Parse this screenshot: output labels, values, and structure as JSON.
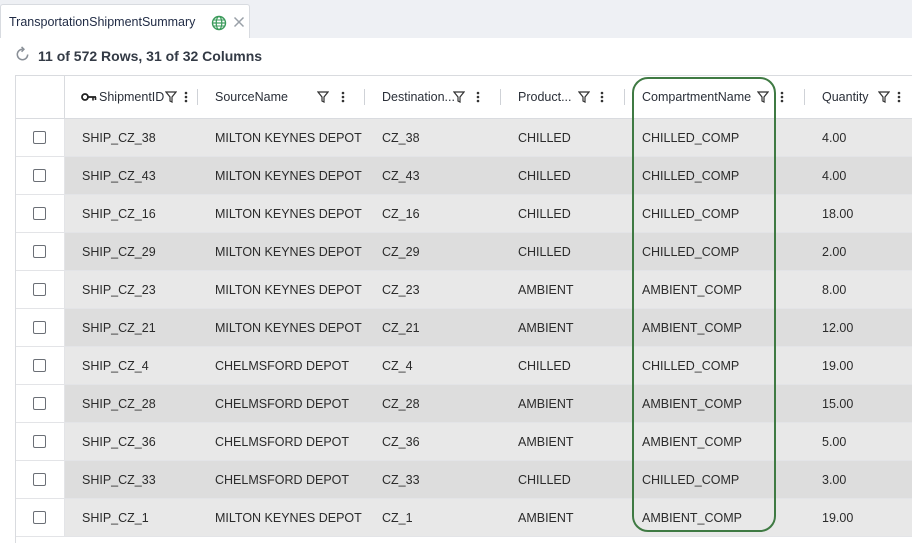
{
  "tab": {
    "title": "TransportationShipmentSummary",
    "globe_icon": "globe-icon",
    "close_icon": "close-icon",
    "globe_color": "#3a9a5a"
  },
  "summary": {
    "text": "11 of 572 Rows, 31 of 32 Columns"
  },
  "grid": {
    "columns": [
      {
        "key": "shipment_id",
        "label": "ShipmentID",
        "has_key_icon": true
      },
      {
        "key": "source_name",
        "label": "SourceName"
      },
      {
        "key": "destination",
        "label": "Destination..."
      },
      {
        "key": "product",
        "label": "Product..."
      },
      {
        "key": "compartment_name",
        "label": "CompartmentName",
        "highlighted": true
      },
      {
        "key": "quantity",
        "label": "Quantity"
      }
    ],
    "rows": [
      [
        "SHIP_CZ_38",
        "MILTON KEYNES DEPOT",
        "CZ_38",
        "CHILLED",
        "CHILLED_COMP",
        "4.00"
      ],
      [
        "SHIP_CZ_43",
        "MILTON KEYNES DEPOT",
        "CZ_43",
        "CHILLED",
        "CHILLED_COMP",
        "4.00"
      ],
      [
        "SHIP_CZ_16",
        "MILTON KEYNES DEPOT",
        "CZ_16",
        "CHILLED",
        "CHILLED_COMP",
        "18.00"
      ],
      [
        "SHIP_CZ_29",
        "MILTON KEYNES DEPOT",
        "CZ_29",
        "CHILLED",
        "CHILLED_COMP",
        "2.00"
      ],
      [
        "SHIP_CZ_23",
        "MILTON KEYNES DEPOT",
        "CZ_23",
        "AMBIENT",
        "AMBIENT_COMP",
        "8.00"
      ],
      [
        "SHIP_CZ_21",
        "MILTON KEYNES DEPOT",
        "CZ_21",
        "AMBIENT",
        "AMBIENT_COMP",
        "12.00"
      ],
      [
        "SHIP_CZ_4",
        "CHELMSFORD DEPOT",
        "CZ_4",
        "CHILLED",
        "CHILLED_COMP",
        "19.00"
      ],
      [
        "SHIP_CZ_28",
        "CHELMSFORD DEPOT",
        "CZ_28",
        "AMBIENT",
        "AMBIENT_COMP",
        "15.00"
      ],
      [
        "SHIP_CZ_36",
        "CHELMSFORD DEPOT",
        "CZ_36",
        "AMBIENT",
        "AMBIENT_COMP",
        "5.00"
      ],
      [
        "SHIP_CZ_33",
        "CHELMSFORD DEPOT",
        "CZ_33",
        "CHILLED",
        "CHILLED_COMP",
        "3.00"
      ],
      [
        "SHIP_CZ_1",
        "MILTON KEYNES DEPOT",
        "CZ_1",
        "AMBIENT",
        "AMBIENT_COMP",
        "19.00"
      ]
    ],
    "highlight_color": "#3f7a43"
  },
  "icons": {
    "refresh": "refresh-icon",
    "key": "key-icon",
    "filter": "filter-icon",
    "menu": "kebab-menu-icon"
  }
}
